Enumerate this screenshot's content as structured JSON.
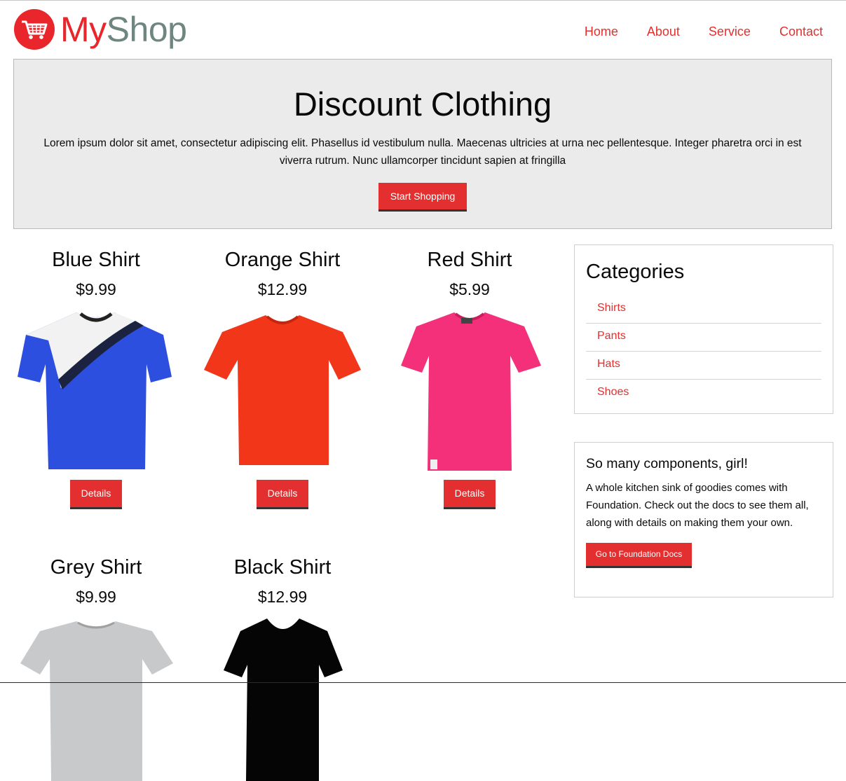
{
  "brand": {
    "name_part1": "My",
    "name_part2": "Shop"
  },
  "nav": {
    "home": "Home",
    "about": "About",
    "service": "Service",
    "contact": "Contact"
  },
  "hero": {
    "title": "Discount Clothing",
    "body": "Lorem ipsum dolor sit amet, consectetur adipiscing elit. Phasellus id vestibulum nulla. Maecenas ultricies at urna nec pellentesque. Integer pharetra orci in est viverra rutrum. Nunc ullamcorper tincidunt sapien at fringilla",
    "cta": "Start Shopping"
  },
  "products": [
    {
      "name": "Blue Shirt",
      "price": "$9.99",
      "button": "Details",
      "color": "#2d4fe0"
    },
    {
      "name": "Orange Shirt",
      "price": "$12.99",
      "button": "Details",
      "color": "#f2361a"
    },
    {
      "name": "Red Shirt",
      "price": "$5.99",
      "button": "Details",
      "color": "#f5307a"
    },
    {
      "name": "Grey Shirt",
      "price": "$9.99",
      "color": "#c8c9ca"
    },
    {
      "name": "Black Shirt",
      "price": "$12.99",
      "color": "#050505"
    }
  ],
  "categories": {
    "title": "Categories",
    "items": [
      "Shirts",
      "Pants",
      "Hats",
      "Shoes"
    ]
  },
  "promo": {
    "title": "So many components, girl!",
    "body": "A whole kitchen sink of goodies comes with Foundation. Check out the docs to see them all, along with details on making them your own.",
    "button": "Go to Foundation Docs"
  },
  "colors": {
    "accent": "#e32f2f",
    "link": "#e0312e",
    "hero_bg": "#ebebeb",
    "logo_grey": "#6f8580"
  }
}
